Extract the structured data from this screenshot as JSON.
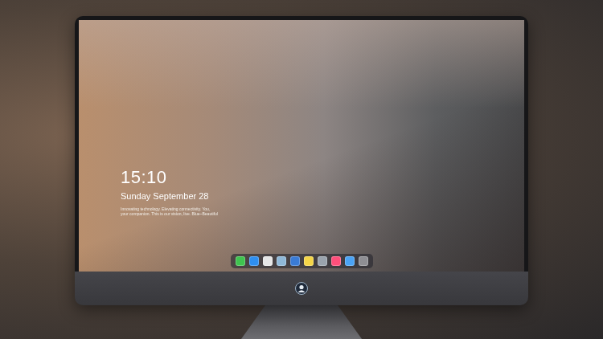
{
  "lock_screen": {
    "time": "15:10",
    "date": "Sunday September 28",
    "tagline": [
      "Innovating technology. Elevating connectivity. You,",
      "your companion. This is our vision, live. Blue~Beautiful"
    ]
  },
  "dock": {
    "apps": [
      {
        "color": "#3fc34f"
      },
      {
        "color": "#2f8ff0"
      },
      {
        "color": "#e6e6e6"
      },
      {
        "color": "#8fb8d8"
      },
      {
        "color": "#3a7bd5"
      },
      {
        "color": "#f5d547"
      },
      {
        "color": "#9aa3ad"
      },
      {
        "color": "#ff4f7b"
      },
      {
        "color": "#4aa3f5"
      },
      {
        "color": "#8e8e93"
      }
    ]
  }
}
